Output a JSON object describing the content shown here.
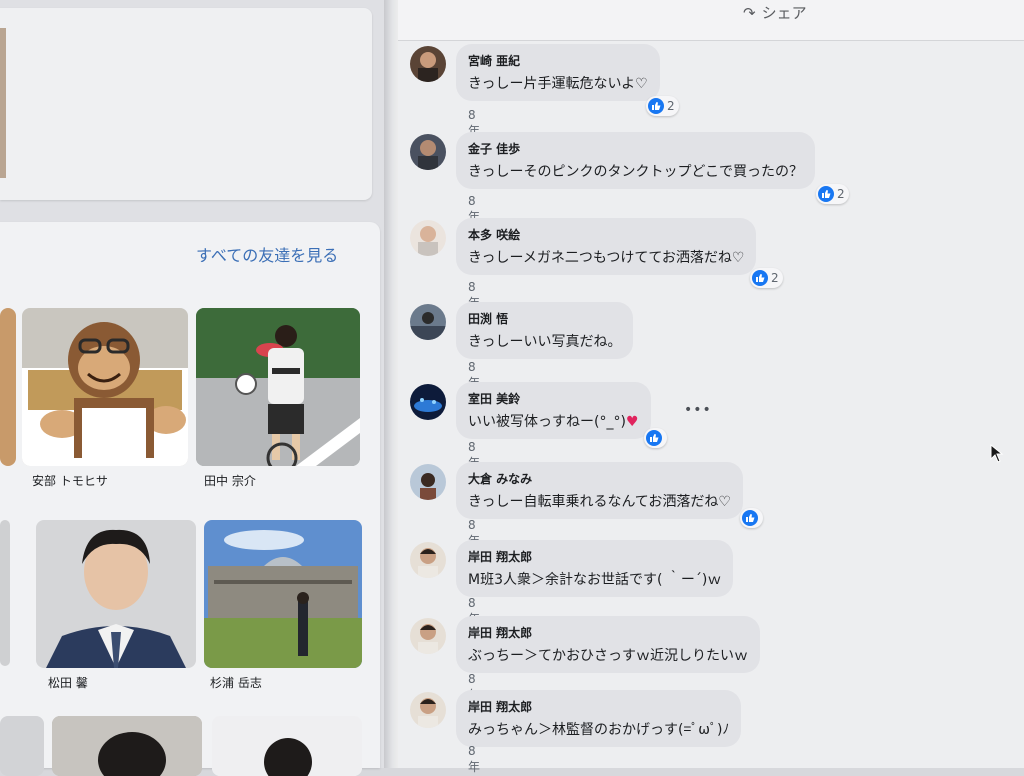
{
  "header": {
    "share_label": "シェア",
    "share_icon": "share-arrow-icon"
  },
  "friends": {
    "see_all_label": "すべての友達を見る",
    "items": [
      {
        "name": "安部 トモヒサ",
        "photo": "monkey-plush-photo"
      },
      {
        "name": "田中 宗介",
        "photo": "cyclist-photo"
      },
      {
        "name": "松田 馨",
        "photo": "suit-portrait-photo"
      },
      {
        "name": "杉浦 岳志",
        "photo": "reichstag-photo"
      }
    ]
  },
  "comments": [
    {
      "author": "宮崎 亜紀",
      "text": "きっしー片手運転危ないよ♡",
      "time": "8年",
      "likes": "2"
    },
    {
      "author": "金子 佳歩",
      "text": "きっしーそのピンクのタンクトップどこで買ったの？",
      "time": "8年",
      "likes": "2"
    },
    {
      "author": "本多 咲絵",
      "text": "きっしーメガネ二つもつけててお洒落だね♡",
      "time": "8年",
      "likes": "2"
    },
    {
      "author": "田渕 悟",
      "text": "きっしーいい写真だね。",
      "time": "8年"
    },
    {
      "author": "室田 美鈴",
      "text": "いい被写体っすねー(°_°)",
      "heart": "♥",
      "time": "8年",
      "likes": ""
    },
    {
      "author": "大倉 みなみ",
      "text": "きっしー自転車乗れるなんてお洒落だね♡",
      "time": "8年",
      "likes": ""
    },
    {
      "author": "岸田 翔太郎",
      "text": "M班3人衆＞余計なお世話です( ｀ー´)ｗ",
      "time": "8年"
    },
    {
      "author": "岸田 翔太郎",
      "text": "ぶっちー＞てかおひさっすｗ近況しりたいｗ",
      "time": "8年"
    },
    {
      "author": "岸田 翔太郎",
      "text": "みっちゃん＞林監督のおかげっす(=ﾟωﾟ)ﾉ",
      "time": "8年"
    }
  ],
  "comment_actions": {
    "more_label": "•••"
  },
  "colors": {
    "like_blue": "#1877f2",
    "link_blue": "#3b6fb6",
    "heart_red": "#e0245e"
  }
}
